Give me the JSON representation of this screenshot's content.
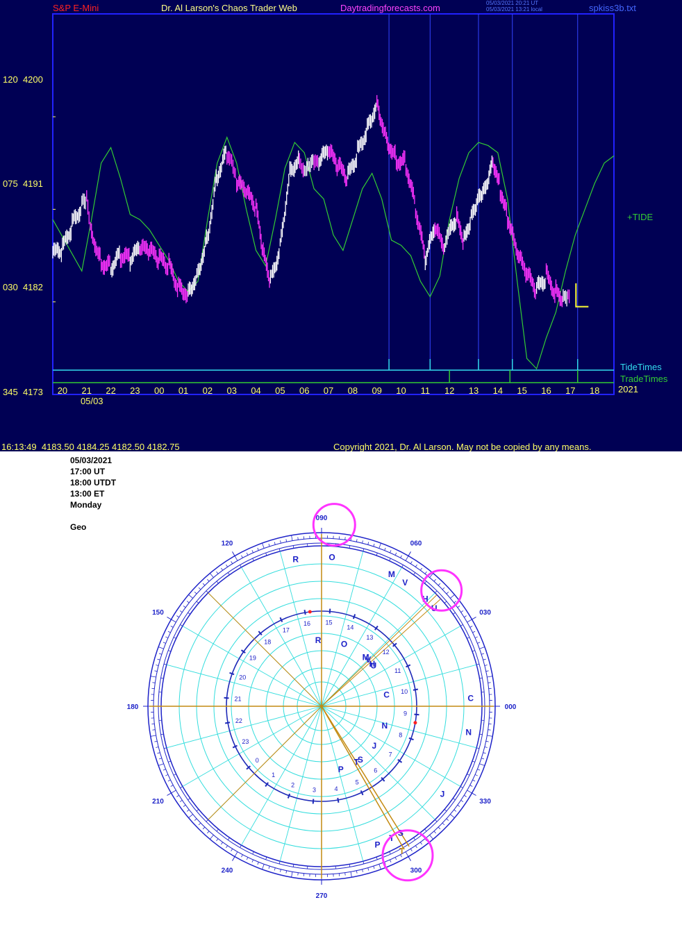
{
  "header": {
    "symbol": "S&P E-Mini",
    "title": "Dr. Al Larson's Chaos Trader Web",
    "site": "Daytradingforecasts.com",
    "stamp1": "05/03/2021 20:21 UT",
    "stamp2": "05/03/2021 13:21 local",
    "file": "spkiss3b.txt"
  },
  "y_axis_labels": [
    {
      "angle": "120",
      "price": "4200"
    },
    {
      "angle": "075",
      "price": "4191"
    },
    {
      "angle": "030",
      "price": "4182"
    },
    {
      "angle": "345",
      "price": "4173"
    }
  ],
  "x_axis": {
    "hours": [
      "20",
      "21",
      "22",
      "23",
      "00",
      "01",
      "02",
      "03",
      "04",
      "05",
      "06",
      "07",
      "08",
      "09",
      "10",
      "11",
      "12",
      "13",
      "14",
      "15",
      "16",
      "17",
      "18"
    ],
    "date_label": "05/03",
    "year_label": "2021"
  },
  "legend": {
    "tide": "+TIDE",
    "tide_times": "TideTimes",
    "trade_times": "TradeTimes"
  },
  "colors": {
    "background": "#000054",
    "price_up": "#ffffff",
    "price_down": "#ff33ff",
    "tide": "#33cc33",
    "tide_times": "#33ddee",
    "trade_times": "#33cc33",
    "axis_text": "#ffff66",
    "frame": "#2222ff",
    "wheel_blue": "#1d22c8",
    "wheel_cyan": "#33dddd",
    "wheel_gold": "#c48a10",
    "highlight": "#ff33ff"
  },
  "status": {
    "time": "16:13:49",
    "values": "4183.50 4184.25 4182.50 4182.75"
  },
  "copyright": "Copyright 2021, Dr. Al Larson. May not be copied by any means.",
  "info": {
    "date": "05/03/2021",
    "ut": "17:00 UT",
    "utdt": "18:00 UTDT",
    "et": "13:00 ET",
    "day": "Monday",
    "mode": "Geo"
  },
  "chart_data": {
    "type": "line",
    "title": "S&P E-Mini",
    "ylim": [
      4173,
      4210
    ],
    "xlim": [
      19.6,
      42.8
    ],
    "x_unit": "hour index (20 = 20:00 on 05/02, 24 = 00:00 on 05/03)",
    "series": [
      {
        "name": "price",
        "x": [
          19.6,
          20.0,
          20.4,
          20.8,
          21.0,
          21.2,
          21.6,
          22.0,
          22.4,
          22.8,
          23.2,
          23.6,
          24.0,
          24.4,
          24.8,
          25.2,
          25.6,
          26.0,
          26.4,
          26.8,
          27.0,
          27.2,
          27.6,
          28.0,
          28.3,
          28.6,
          29.0,
          29.4,
          29.8,
          30.0,
          30.2,
          30.4,
          30.6,
          31.0,
          31.4,
          31.8,
          32.2,
          32.6,
          33.0,
          33.4,
          33.8,
          34.2,
          34.6,
          35.0,
          35.4,
          35.8,
          36.0,
          36.3,
          36.6,
          36.9,
          37.2,
          37.5,
          37.8,
          38.1,
          38.4,
          38.8,
          39.2,
          39.6,
          40.0,
          40.4,
          40.7,
          40.9,
          41.0
        ],
        "values": [
          4186.5,
          4187.0,
          4189.5,
          4191.5,
          4192.0,
          4189.0,
          4186.0,
          4185.5,
          4186.5,
          4186.0,
          4187.0,
          4186.8,
          4186.0,
          4185.5,
          4183.5,
          4183.0,
          4185.0,
          4188.5,
          4194.5,
          4196.5,
          4196.0,
          4193.5,
          4192.5,
          4191.0,
          4186.5,
          4184.0,
          4187.5,
          4195.0,
          4196.0,
          4195.2,
          4195.8,
          4196.0,
          4195.5,
          4196.5,
          4195.0,
          4194.0,
          4196.5,
          4199.0,
          4201.5,
          4198.0,
          4196.0,
          4195.5,
          4191.0,
          4186.0,
          4189.0,
          4187.0,
          4188.5,
          4190.0,
          4188.0,
          4190.5,
          4192.5,
          4193.5,
          4196.0,
          4193.0,
          4190.0,
          4186.5,
          4184.5,
          4183.0,
          4184.5,
          4183.0,
          4182.5,
          4182.8,
          4182.75
        ]
      },
      {
        "name": "+TIDE",
        "x": [
          19.6,
          20.2,
          20.8,
          21.2,
          21.6,
          22.0,
          22.4,
          22.8,
          23.2,
          23.6,
          24.0,
          24.4,
          24.8,
          25.2,
          25.6,
          26.0,
          26.4,
          26.8,
          27.2,
          27.6,
          28.0,
          28.4,
          28.8,
          29.2,
          29.6,
          30.0,
          30.4,
          30.8,
          31.2,
          31.6,
          32.0,
          32.4,
          32.8,
          33.2,
          33.6,
          34.0,
          34.4,
          34.8,
          35.2,
          35.6,
          36.0,
          36.4,
          36.8,
          37.2,
          37.6,
          38.0,
          38.4,
          38.8,
          39.2,
          39.6,
          40.0,
          40.4,
          40.8,
          41.2,
          41.6,
          42.0,
          42.4,
          42.8
        ],
        "values": [
          4190.0,
          4187.5,
          4185.0,
          4190.0,
          4195.5,
          4197.0,
          4194.0,
          4190.5,
          4190.0,
          4189.0,
          4187.5,
          4186.0,
          4184.0,
          4183.0,
          4184.0,
          4190.0,
          4195.5,
          4198.0,
          4195.5,
          4191.0,
          4187.0,
          4185.5,
          4190.0,
          4195.0,
          4197.5,
          4196.5,
          4193.0,
          4192.0,
          4188.5,
          4187.0,
          4190.0,
          4193.0,
          4194.5,
          4192.0,
          4188.0,
          4187.5,
          4186.5,
          4184.0,
          4182.5,
          4184.5,
          4190.0,
          4194.0,
          4196.5,
          4197.5,
          4197.2,
          4196.5,
          4192.0,
          4184.0,
          4176.5,
          4175.5,
          4178.5,
          4181.0,
          4185.0,
          4188.5,
          4191.0,
          4193.5,
          4195.5,
          4196.2
        ]
      }
    ],
    "tide_times": [
      33.5,
      35.2,
      37.2,
      38.6,
      41.3
    ],
    "trade_times": [
      36.0,
      38.5,
      41.3
    ]
  },
  "wheel": {
    "degree_labels": [
      "000",
      "030",
      "060",
      "090",
      "120",
      "150",
      "180",
      "210",
      "240",
      "270",
      "300",
      "330"
    ],
    "hour_ring": [
      "16",
      "17",
      "18",
      "19",
      "20",
      "21",
      "22",
      "23",
      "0",
      "1",
      "2",
      "3",
      "4",
      "5",
      "6",
      "7",
      "8",
      "9",
      "10",
      "11",
      "12",
      "13",
      "14",
      "15"
    ],
    "outer_planets": [
      {
        "g": "O",
        "a": 86
      },
      {
        "g": "U",
        "a": 41
      },
      {
        "g": "H",
        "a": 46
      },
      {
        "g": "M",
        "a": 62
      },
      {
        "g": "V",
        "a": 56
      },
      {
        "g": "R",
        "a": 100
      },
      {
        "g": "C",
        "a": 3
      },
      {
        "g": "N",
        "a": 350
      },
      {
        "g": "J",
        "a": 324
      },
      {
        "g": "S",
        "a": 302
      },
      {
        "g": "T",
        "a": 298
      },
      {
        "g": "P",
        "a": 292
      }
    ],
    "inner_planets": [
      {
        "g": "O",
        "a": 70
      },
      {
        "g": "R",
        "a": 93
      },
      {
        "g": "M",
        "a": 48
      },
      {
        "g": "V",
        "a": 45
      },
      {
        "g": "H",
        "a": 40
      },
      {
        "g": "U",
        "a": 38
      },
      {
        "g": "C",
        "a": 10
      },
      {
        "g": "N",
        "a": 343
      },
      {
        "g": "J",
        "a": 323
      },
      {
        "g": "S",
        "a": 306
      },
      {
        "g": "T",
        "a": 302
      },
      {
        "g": "P",
        "a": 287
      }
    ],
    "transit_marker": "T"
  }
}
